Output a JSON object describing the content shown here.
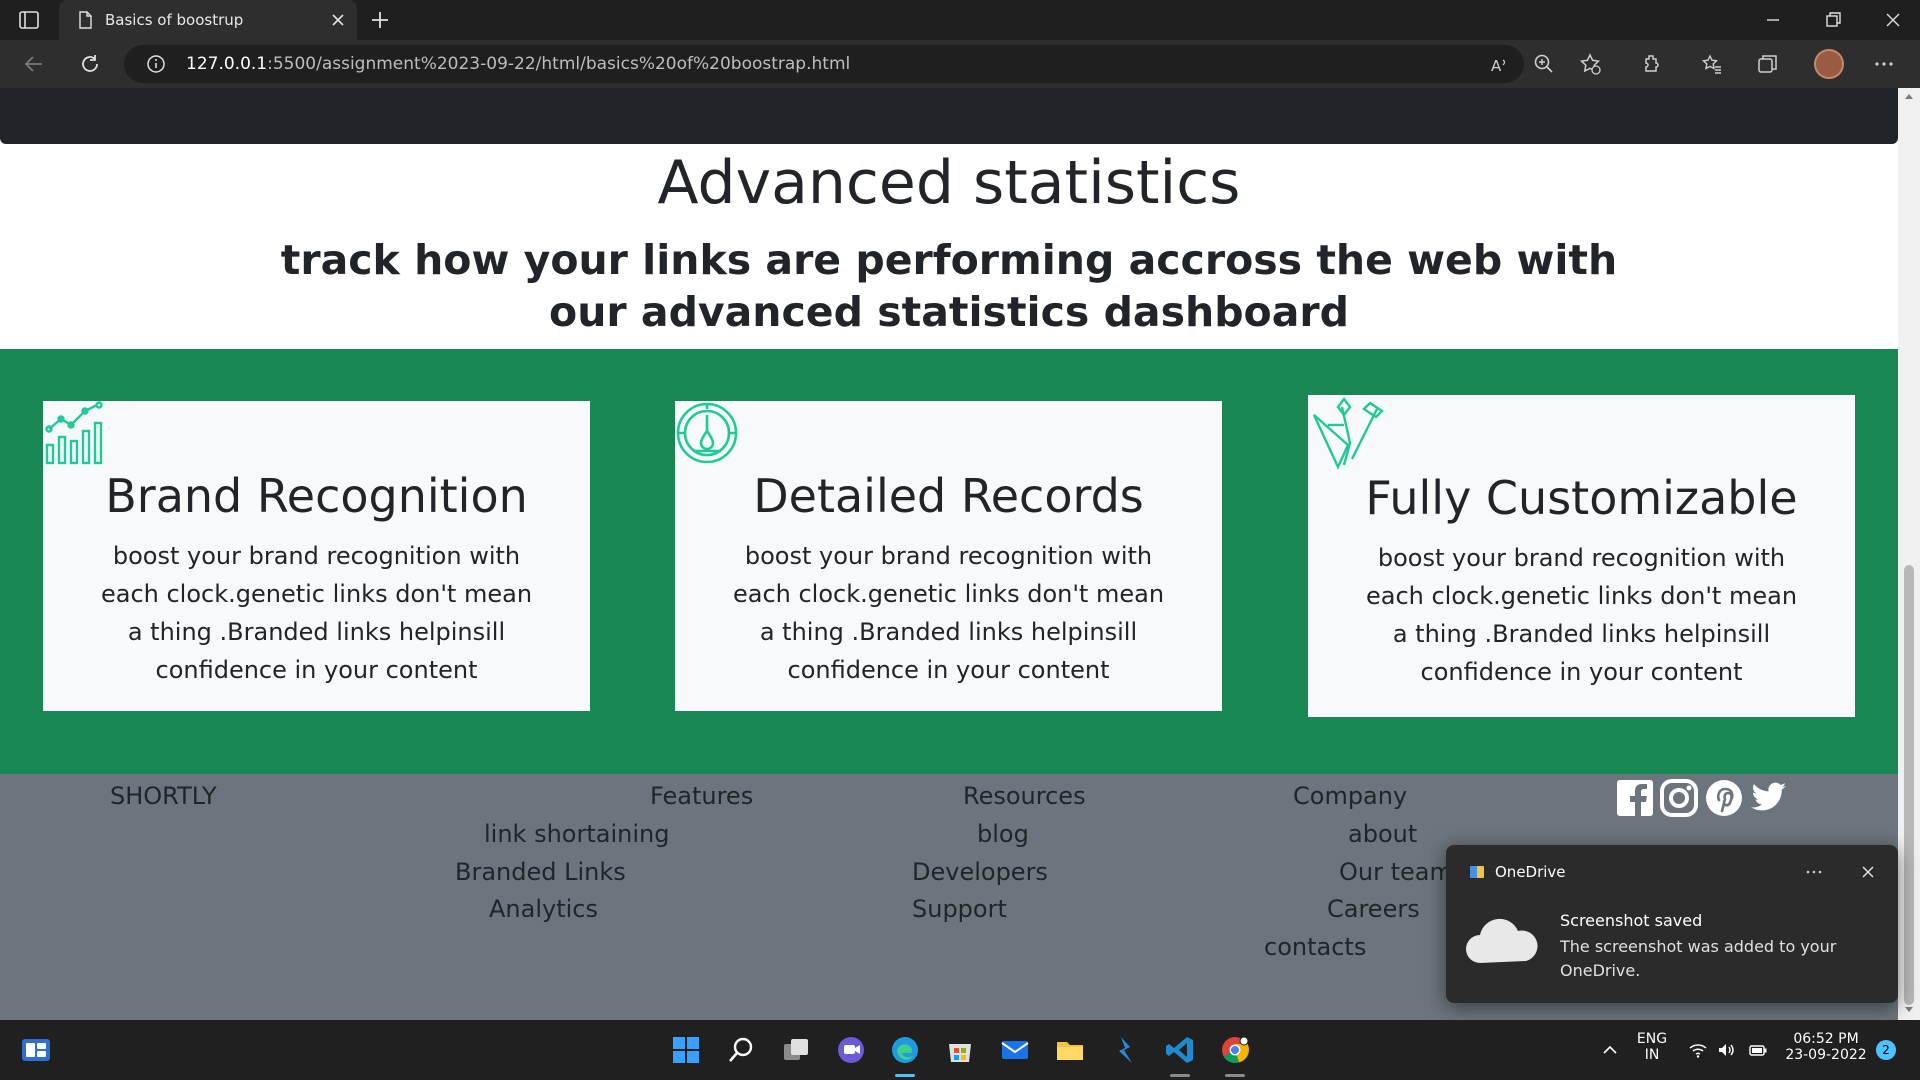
{
  "browser": {
    "tab_title": "Basics of boostrup",
    "url_host": "127.0.0.1",
    "url_rest": ":5500/assignment%2023-09-22/html/basics%20of%20boostrap.html"
  },
  "page": {
    "heading": "Advanced statistics",
    "subheading": "track how your links are performing accross the web with our advanced statistics dashboard",
    "cards": [
      {
        "icon": "chart-growth-icon",
        "title": "Brand Recognition",
        "text": "boost your brand recognition with each clock.genetic links don't mean a thing .Branded links helpinsill confidence in your content"
      },
      {
        "icon": "speedometer-icon",
        "title": "Detailed Records",
        "text": "boost your brand recognition with each clock.genetic links don't mean a thing .Branded links helpinsill confidence in your content"
      },
      {
        "icon": "design-tools-icon",
        "title": "Fully Customizable",
        "text": "boost your brand recognition with each clock.genetic links don't mean a thing .Branded links helpinsill confidence in your content"
      }
    ],
    "footer": {
      "brand": "SHORTLY",
      "features": {
        "title": "Features",
        "links": [
          "link shortaining",
          "Branded Links",
          "Analytics"
        ]
      },
      "resources": {
        "title": "Resources",
        "links": [
          "blog",
          "Developers",
          "Support"
        ]
      },
      "company": {
        "title": "Company",
        "links": [
          "about",
          "Our team",
          "Careers",
          "contacts"
        ]
      },
      "social": [
        "facebook-icon",
        "instagram-icon",
        "pinterest-icon",
        "twitter-icon"
      ]
    }
  },
  "toast": {
    "app": "OneDrive",
    "title": "Screenshot saved",
    "body": "The screenshot was added to your OneDrive."
  },
  "taskbar": {
    "lang_top": "ENG",
    "lang_bottom": "IN",
    "time": "06:52 PM",
    "date": "23-09-2022",
    "notifications": "2"
  },
  "colors": {
    "accent_green": "#198754",
    "footer_gray": "#6c757d",
    "icon_teal": "#20c997"
  }
}
